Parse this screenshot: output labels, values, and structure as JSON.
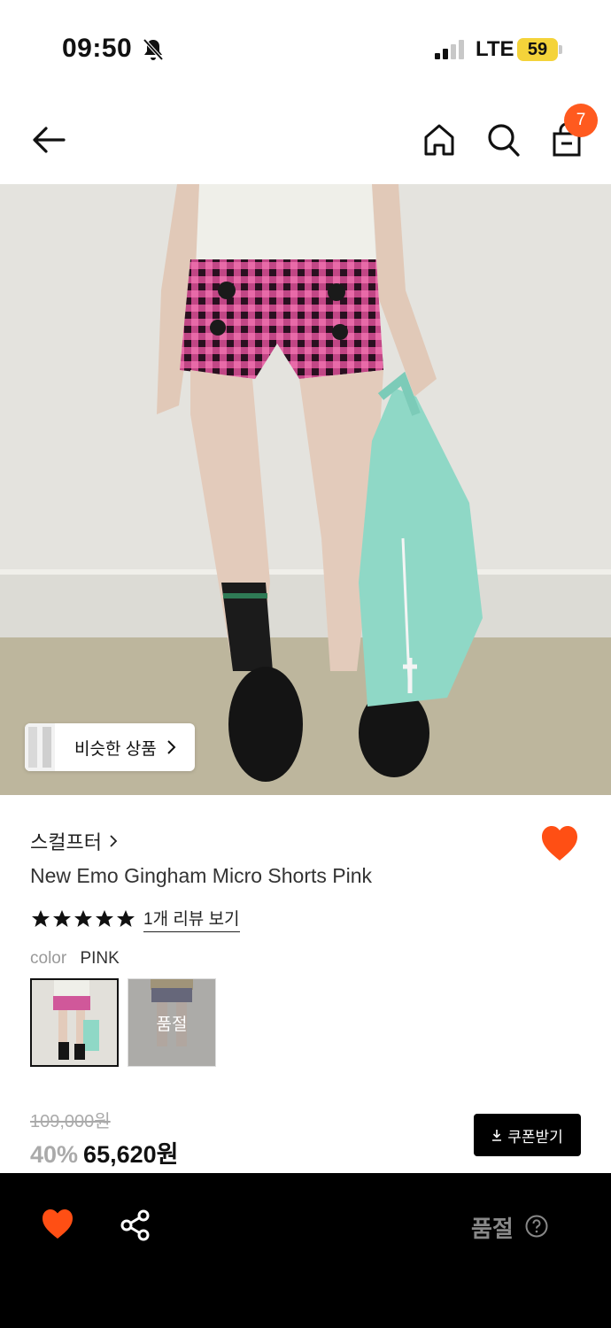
{
  "status_bar": {
    "time": "09:50",
    "network": "LTE",
    "battery": "59"
  },
  "header": {
    "cart_count": "7",
    "icons": [
      "back-arrow-icon",
      "home-icon",
      "search-icon",
      "shopping-bag-icon"
    ]
  },
  "image": {
    "similar_label": "비슷한 상품"
  },
  "product": {
    "brand": "스컬프터",
    "name": "New Emo Gingham Micro Shorts Pink",
    "rating_stars": 5,
    "review_link": "1개 리뷰 보기",
    "color_label": "color",
    "color_value": "PINK",
    "sold_out_swatch": "품절",
    "price_original": "109,000원",
    "discount": "40%",
    "price_final": "65,620원",
    "coupon_label": "쿠폰받기"
  },
  "bottom_bar": {
    "status": "품절"
  },
  "colors": {
    "accent": "#ff5a1f",
    "black": "#000000",
    "muted": "#aaaaaa"
  }
}
